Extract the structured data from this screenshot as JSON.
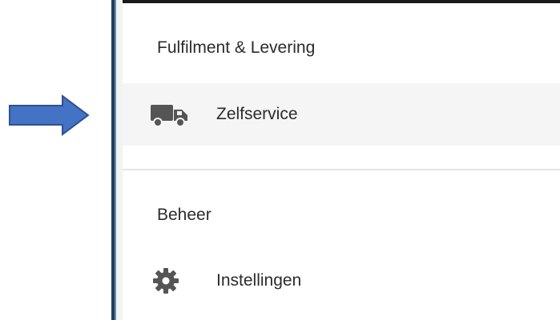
{
  "sections": [
    {
      "title": "Fulfilment & Levering",
      "items": [
        {
          "label": "Zelfservice",
          "icon": "truck-icon",
          "selected": true
        }
      ]
    },
    {
      "title": "Beheer",
      "items": [
        {
          "label": "Instellingen",
          "icon": "gear-icon",
          "selected": false
        }
      ]
    }
  ],
  "annotation": {
    "icon": "arrow-right-icon",
    "color": "#4472c4"
  },
  "colors": {
    "panel_edge": "#1f3f5e",
    "selected_bg": "#f5f5f5",
    "icon": "#555555"
  }
}
